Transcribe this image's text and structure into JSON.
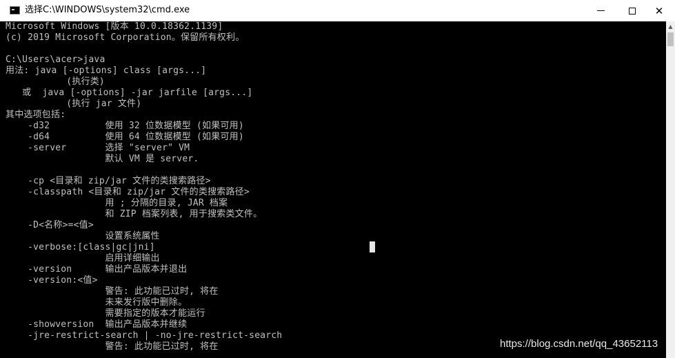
{
  "window": {
    "title": "选择C:\\WINDOWS\\system32\\cmd.exe",
    "icon": "console-app-icon",
    "controls": {
      "minimize": "minimize-icon",
      "maximize": "maximize-icon",
      "close": "✕"
    }
  },
  "console": {
    "lines": [
      "Microsoft Windows [版本 10.0.18362.1139]",
      "(c) 2019 Microsoft Corporation。保留所有权利。",
      "",
      "C:\\Users\\acer>java",
      "用法: java [-options] class [args...]",
      "           (执行类)",
      "   或  java [-options] -jar jarfile [args...]",
      "           (执行 jar 文件)",
      "其中选项包括:",
      "    -d32          使用 32 位数据模型 (如果可用)",
      "    -d64          使用 64 位数据模型 (如果可用)",
      "    -server       选择 \"server\" VM",
      "                  默认 VM 是 server.",
      "",
      "    -cp <目录和 zip/jar 文件的类搜索路径>",
      "    -classpath <目录和 zip/jar 文件的类搜索路径>",
      "                  用 ; 分隔的目录, JAR 档案",
      "                  和 ZIP 档案列表, 用于搜索类文件。",
      "    -D<名称>=<值>",
      "                  设置系统属性",
      "    -verbose:[class|gc|jni]",
      "                  启用详细输出",
      "    -version      输出产品版本并退出",
      "    -version:<值>",
      "                  警告: 此功能已过时, 将在",
      "                  未来发行版中删除。",
      "                  需要指定的版本才能运行",
      "    -showversion  输出产品版本并继续",
      "    -jre-restrict-search | -no-jre-restrict-search",
      "                  警告: 此功能已过时, 将在"
    ]
  },
  "watermark": "https://blog.csdn.net/qq_43652113",
  "colors": {
    "console_bg": "#000000",
    "console_text": "#c0c0c0",
    "titlebar_bg": "#ffffff"
  }
}
